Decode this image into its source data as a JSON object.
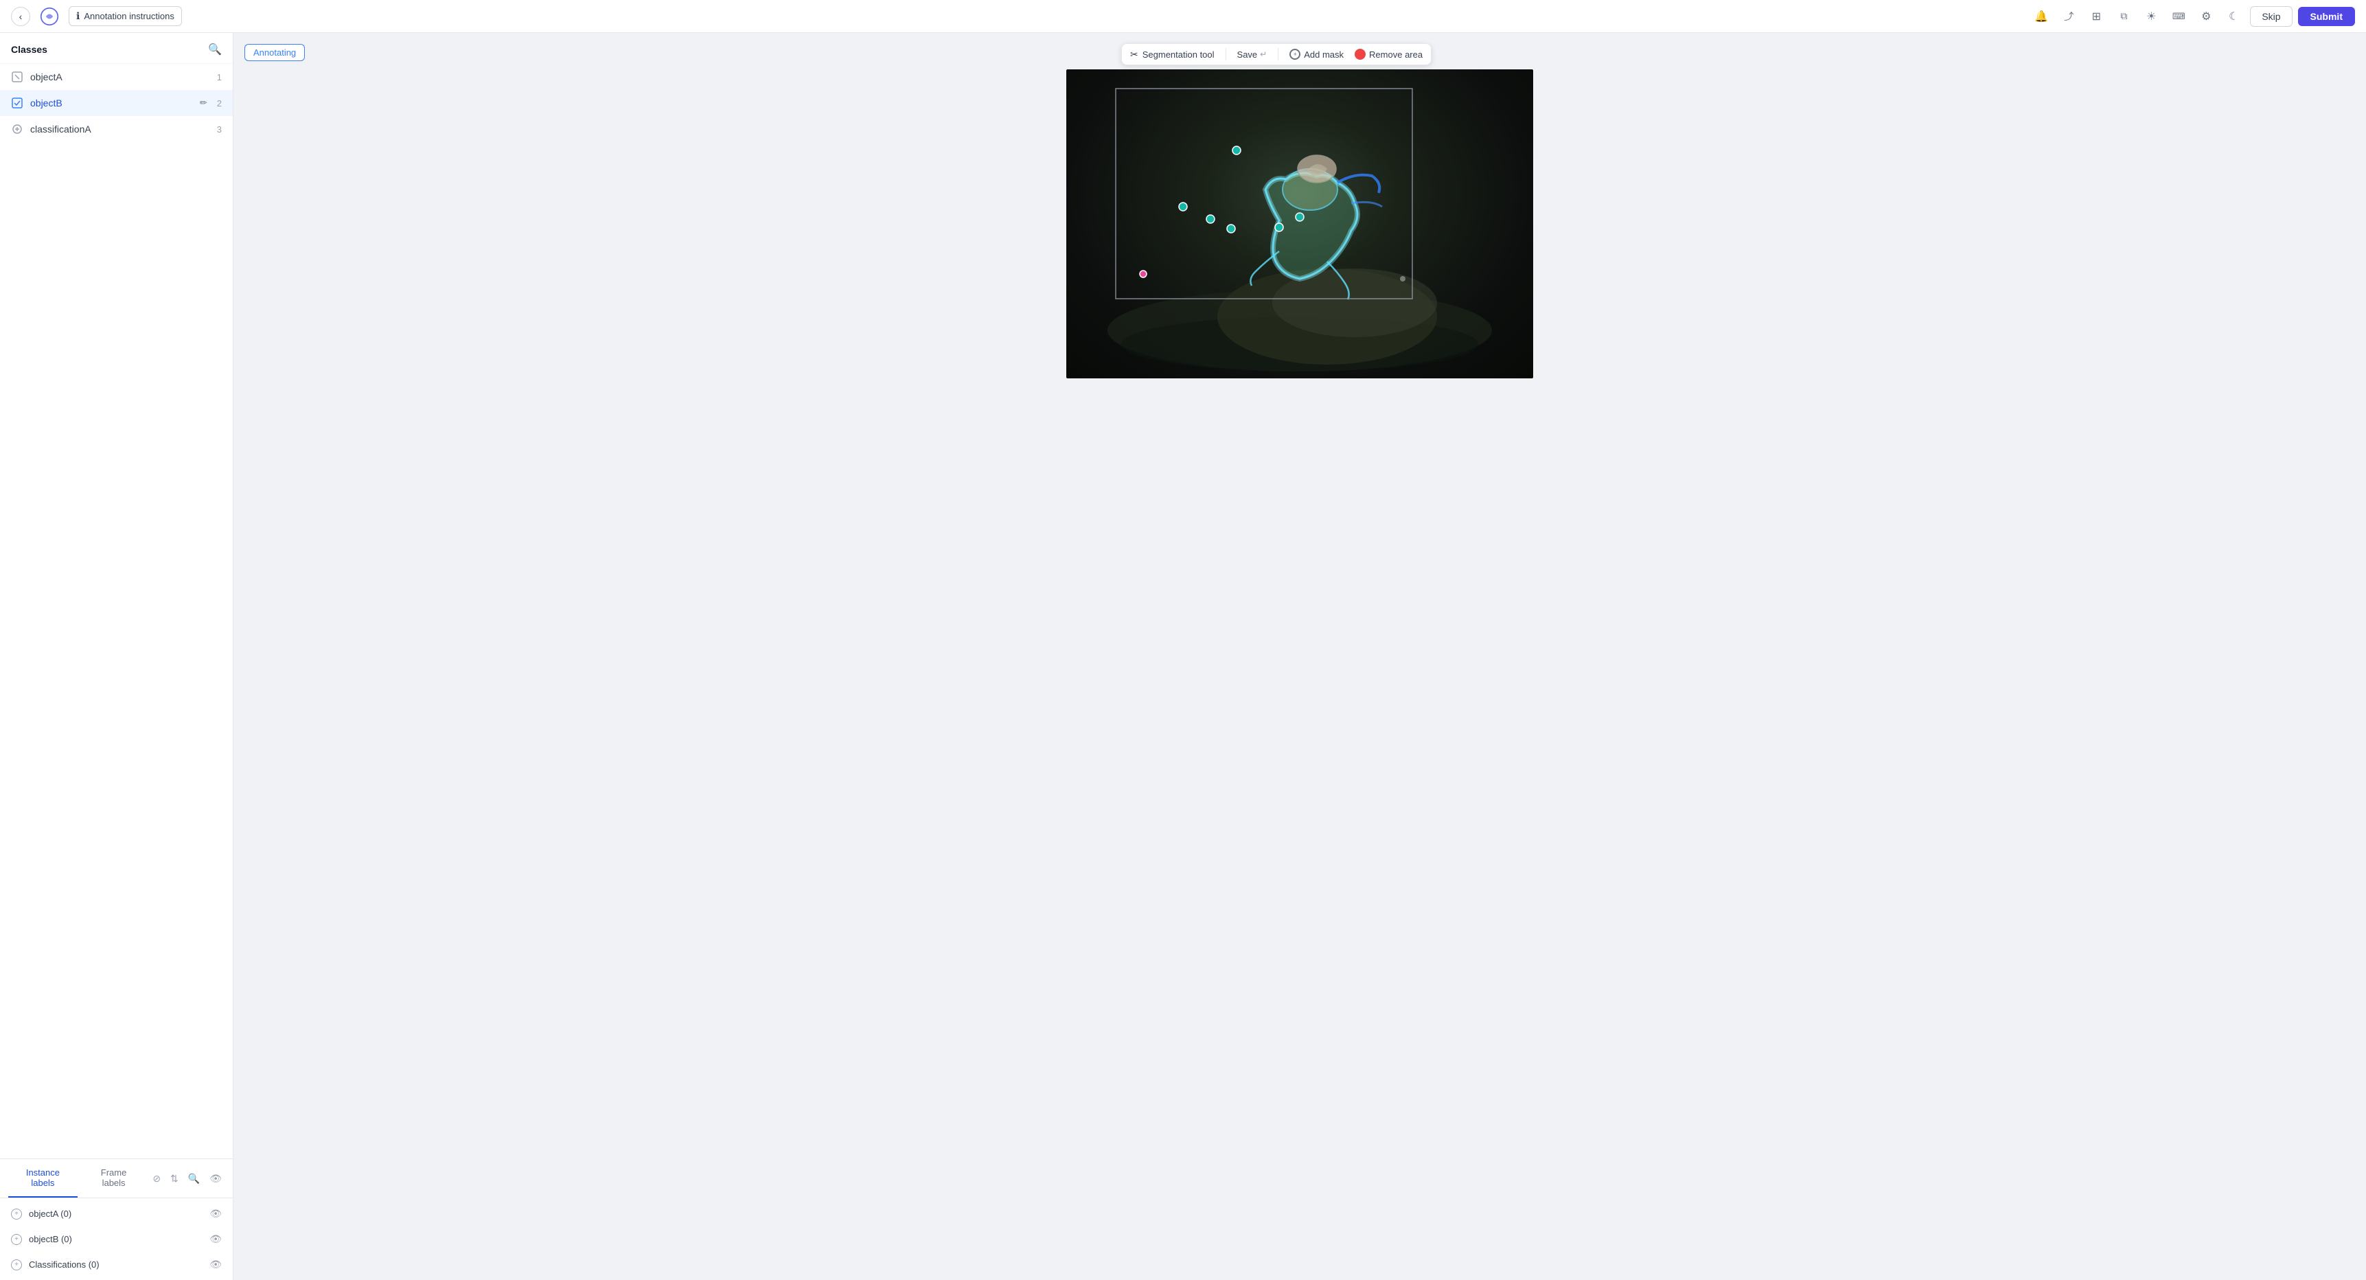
{
  "header": {
    "annotation_instructions_label": "Annotation instructions",
    "skip_label": "Skip",
    "submit_label": "Submit"
  },
  "sidebar": {
    "classes_title": "Classes",
    "classes": [
      {
        "id": "objectA",
        "name": "objectA",
        "count": 1,
        "active": false
      },
      {
        "id": "objectB",
        "name": "objectB",
        "count": 2,
        "active": true
      },
      {
        "id": "classificationA",
        "name": "classificationA",
        "count": 3,
        "active": false
      }
    ],
    "tabs": [
      {
        "id": "instance",
        "label": "Instance labels",
        "active": true
      },
      {
        "id": "frame",
        "label": "Frame labels",
        "active": false
      }
    ],
    "instance_items": [
      {
        "id": "objectA0",
        "name": "objectA (0)"
      },
      {
        "id": "objectB0",
        "name": "objectB (0)"
      },
      {
        "id": "classifications0",
        "name": "Classifications (0)"
      }
    ]
  },
  "canvas": {
    "annotating_badge": "Annotating",
    "segmentation_tool_label": "Segmentation tool",
    "save_label": "Save",
    "save_shortcut": "↵",
    "add_mask_label": "Add mask",
    "remove_area_label": "Remove area"
  }
}
